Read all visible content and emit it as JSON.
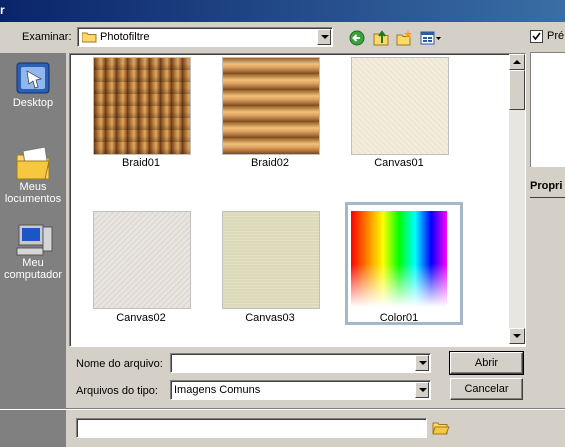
{
  "window": {
    "title": "r"
  },
  "toolbar": {
    "look_in_label": "Examinar:",
    "look_in_value": "Photofiltre",
    "preview_label": "Pré",
    "preview_checked": true
  },
  "places": [
    {
      "label": "Desktop",
      "icon": "desktop-icon"
    },
    {
      "label": "Meus\nlocumentos",
      "icon": "my-documents-icon"
    },
    {
      "label": "Meu\ncomputador",
      "icon": "my-computer-icon"
    }
  ],
  "files": [
    {
      "name": "Braid01",
      "texture": "braid1"
    },
    {
      "name": "Braid02",
      "texture": "braid2"
    },
    {
      "name": "Canvas01",
      "texture": "canvas1"
    },
    {
      "name": "Canvas02",
      "texture": "canvas2"
    },
    {
      "name": "Canvas03",
      "texture": "canvas3"
    },
    {
      "name": "Color01",
      "texture": "rainbow",
      "selected": true
    }
  ],
  "form": {
    "filename_label": "Nome do arquivo:",
    "filename_value": "",
    "filetype_label": "Arquivos do tipo:",
    "filetype_value": "Imagens Comuns",
    "open_button": "Abrir",
    "cancel_button": "Cancelar"
  },
  "properties": {
    "label": "Propri"
  },
  "bottom": {
    "path_value": ""
  }
}
